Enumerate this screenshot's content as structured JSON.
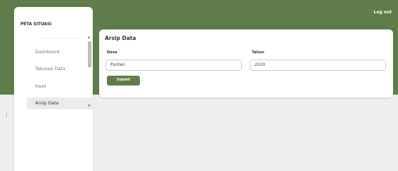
{
  "header": {
    "logout_label": "Log out"
  },
  "sidebar": {
    "brand": "PETA SITUASI",
    "items": [
      {
        "label": "Dashboard",
        "active": false
      },
      {
        "label": "Tabulasi Data",
        "active": false
      },
      {
        "label": "Hasil",
        "active": false
      },
      {
        "label": "Arsip Data",
        "active": true
      }
    ]
  },
  "main": {
    "card_title": "Arsip Data",
    "fields": [
      {
        "label": "Desa",
        "value": "Punten"
      },
      {
        "label": "Tahun",
        "value": "2020"
      }
    ],
    "submit_label": "Submit"
  },
  "colors": {
    "brand_green": "#5f7d48",
    "background": "#eeeeee",
    "card": "#ffffff"
  }
}
